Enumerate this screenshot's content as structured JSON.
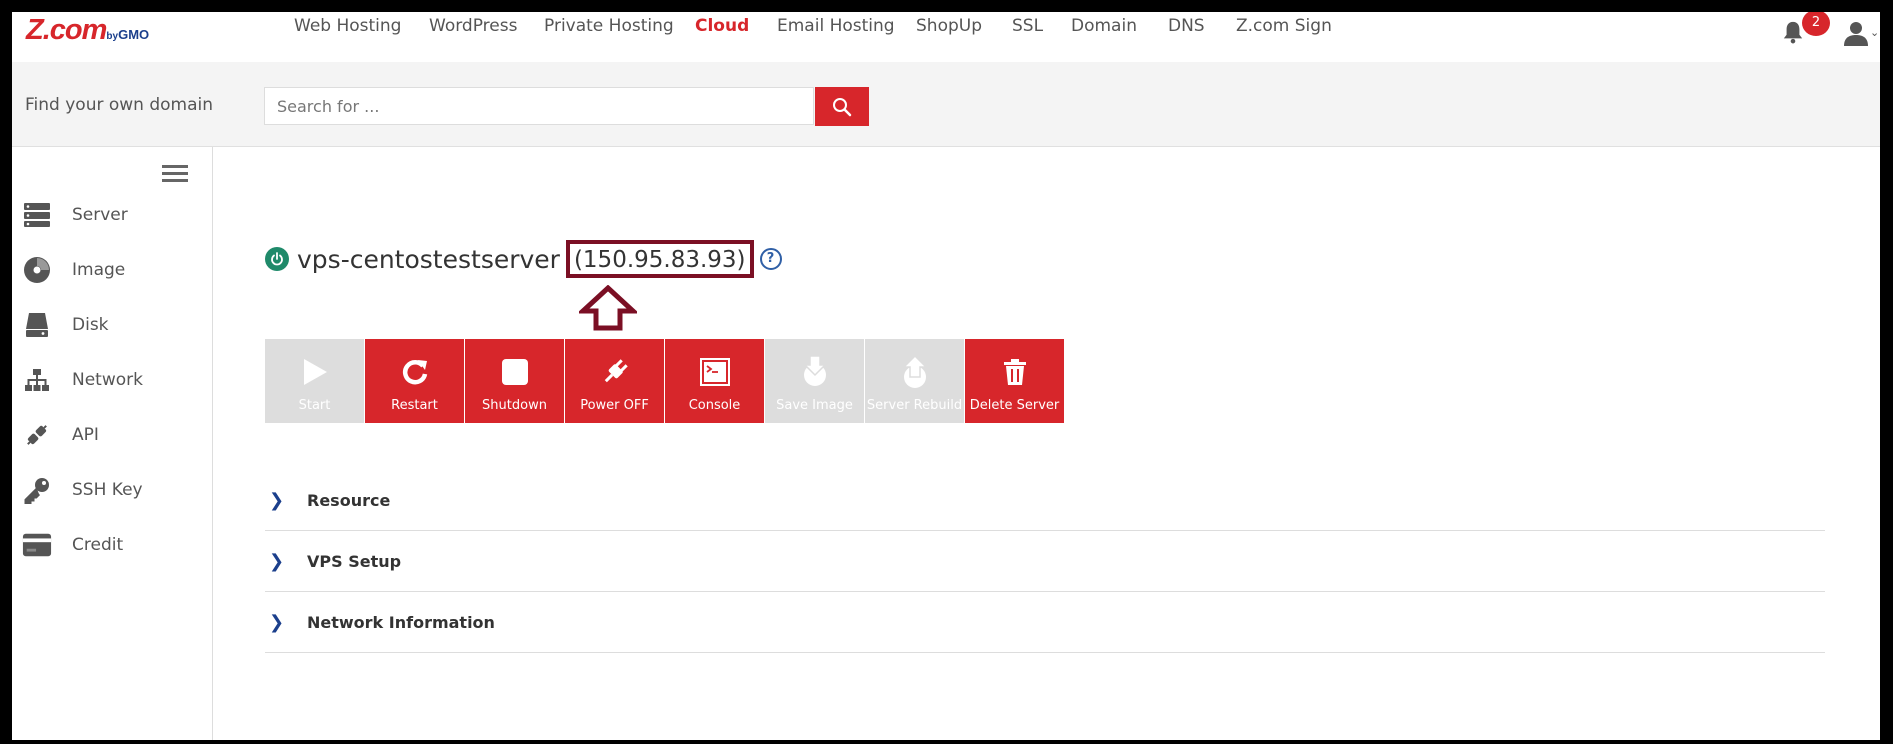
{
  "brand": {
    "logo_main": "Z.com",
    "logo_by": "by",
    "logo_gmo": "GMO",
    "accent": "#d7262b"
  },
  "nav": [
    {
      "label": "Web Hosting",
      "active": false
    },
    {
      "label": "WordPress",
      "active": false
    },
    {
      "label": "Private Hosting",
      "active": false
    },
    {
      "label": "Cloud",
      "active": true
    },
    {
      "label": "Email Hosting",
      "active": false
    },
    {
      "label": "ShopUp",
      "active": false
    },
    {
      "label": "SSL",
      "active": false
    },
    {
      "label": "Domain",
      "active": false
    },
    {
      "label": "DNS",
      "active": false
    },
    {
      "label": "Z.com Sign",
      "active": false
    }
  ],
  "notifications": {
    "count": "2"
  },
  "search": {
    "label": "Find your own domain",
    "placeholder": "Search for ..."
  },
  "sidebar": {
    "items": [
      {
        "label": "Server",
        "icon": "server-icon"
      },
      {
        "label": "Image",
        "icon": "disc-icon"
      },
      {
        "label": "Disk",
        "icon": "disk-icon"
      },
      {
        "label": "Network",
        "icon": "network-icon"
      },
      {
        "label": "API",
        "icon": "api-icon"
      },
      {
        "label": "SSH Key",
        "icon": "key-icon"
      },
      {
        "label": "Credit",
        "icon": "credit-card-icon"
      }
    ]
  },
  "server": {
    "name": "vps-centostestserver",
    "ip": "(150.95.83.93)",
    "status": "running"
  },
  "actions": [
    {
      "label": "Start",
      "icon": "play-icon",
      "enabled": false
    },
    {
      "label": "Restart",
      "icon": "restart-icon",
      "enabled": true
    },
    {
      "label": "Shutdown",
      "icon": "stop-icon",
      "enabled": true
    },
    {
      "label": "Power OFF",
      "icon": "plug-icon",
      "enabled": true
    },
    {
      "label": "Console",
      "icon": "console-icon",
      "enabled": true
    },
    {
      "label": "Save Image",
      "icon": "save-image-icon",
      "enabled": false
    },
    {
      "label": "Server Rebuild",
      "icon": "rebuild-icon",
      "enabled": false
    },
    {
      "label": "Delete Server",
      "icon": "trash-icon",
      "enabled": true
    }
  ],
  "sections": [
    {
      "title": "Resource"
    },
    {
      "title": "VPS Setup"
    },
    {
      "title": "Network Information"
    }
  ]
}
